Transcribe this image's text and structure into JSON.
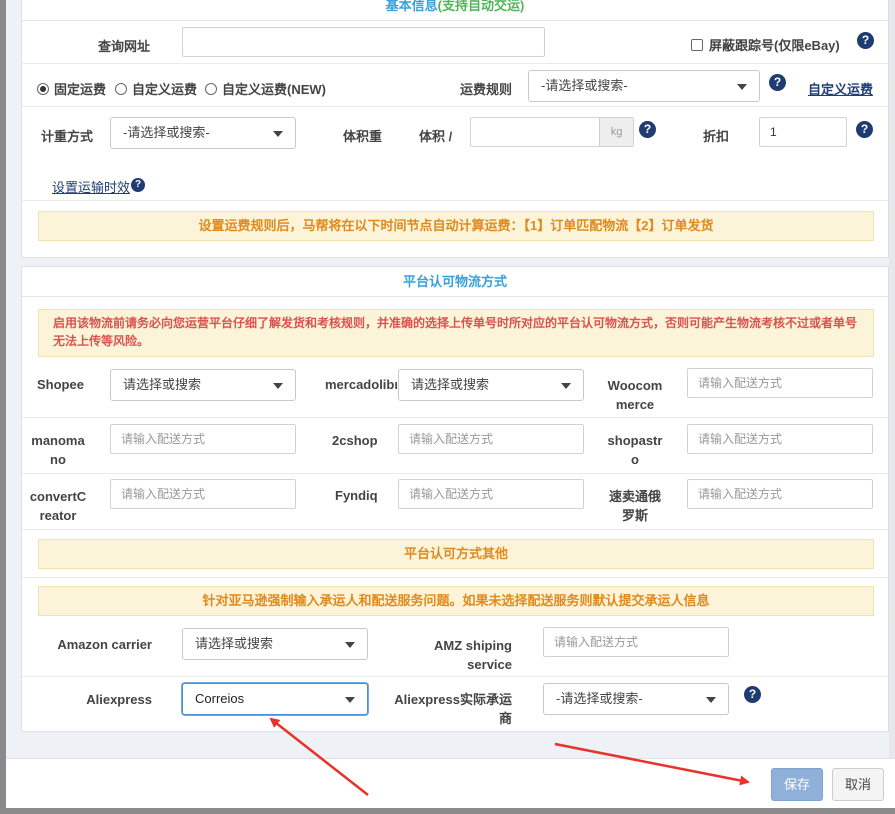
{
  "basic": {
    "header_main": "基本信息",
    "header_sub": "(支持自动交运)",
    "query_url_label": "查询网址",
    "query_url_value": "",
    "hide_tracking_label": "屏蔽跟踪号(仅限eBay)",
    "radio_fixed": "固定运费",
    "radio_custom": "自定义运费",
    "radio_custom_new": "自定义运费(NEW)",
    "freight_rule_label": "运费规则",
    "freight_rule_value": "-请选择或搜索-",
    "custom_freight_link": "自定义运费",
    "weigh_method_label": "计重方式",
    "weigh_method_value": "-请选择或搜索-",
    "vol_weight_label": "体积重",
    "volume_label": "体积 /",
    "volume_value": "",
    "volume_unit": "kg",
    "discount_label": "折扣",
    "discount_value": "1",
    "transit_link": "设置运输时效",
    "notice": "设置运费规则后，马帮将在以下时间节点自动计算运费：【1】订单匹配物流【2】订单发货"
  },
  "platform": {
    "header": "平台认可物流方式",
    "warning": "启用该物流前请务必向您运营平台仔细了解发货和考核规则，并准确的选择上传单号时所对应的平台认可物流方式，否则可能产生物流考核不过或者单号无法上传等风险。",
    "row1": {
      "shopee_label": "Shopee",
      "shopee_value": "请选择或搜索",
      "mercadolibre_label": "mercadolibre",
      "mercadolibre_value": "请选择或搜索",
      "woocommerce_label_1": "Woocom",
      "woocommerce_label_2": "merce",
      "woocommerce_placeholder": "请输入配送方式"
    },
    "row2": {
      "manomano_label_1": "manoma",
      "manomano_label_2": "no",
      "manomano_placeholder": "请输入配送方式",
      "twocshop_label": "2cshop",
      "twocshop_placeholder": "请输入配送方式",
      "shopastro_label_1": "shopastr",
      "shopastro_label_2": "o",
      "shopastro_placeholder": "请输入配送方式"
    },
    "row3": {
      "convert_label_1": "convertC",
      "convert_label_2": "reator",
      "convert_placeholder": "请输入配送方式",
      "fyndiq_label": "Fyndiq",
      "fyndiq_placeholder": "请输入配送方式",
      "russia_label_1": "速卖通俄",
      "russia_label_2": "罗斯",
      "russia_placeholder": "请输入配送方式"
    },
    "other_notice": "平台认可方式其他",
    "amazon_notice": "针对亚马逊强制输入承运人和配送服务问题。如果未选择配送服务则默认提交承运人信息",
    "amazon_carrier_label": "Amazon carrier",
    "amazon_carrier_value": "请选择或搜索",
    "amz_service_label_1": "AMZ shiping",
    "amz_service_label_2": "service",
    "amz_service_placeholder": "请输入配送方式",
    "aliexpress_label": "Aliexpress",
    "aliexpress_value": "Correios",
    "ali_carrier_label_1": "Aliexpress实际承运",
    "ali_carrier_label_2": "商",
    "ali_carrier_value": "-请选择或搜索-"
  },
  "footer": {
    "save_label": "保存",
    "cancel_label": "取消"
  },
  "colors": {
    "accent": "#36a2dc",
    "notice_text": "#e08a1e",
    "warning_text": "#d9534f",
    "annotation_arrow": "#e8322b"
  }
}
